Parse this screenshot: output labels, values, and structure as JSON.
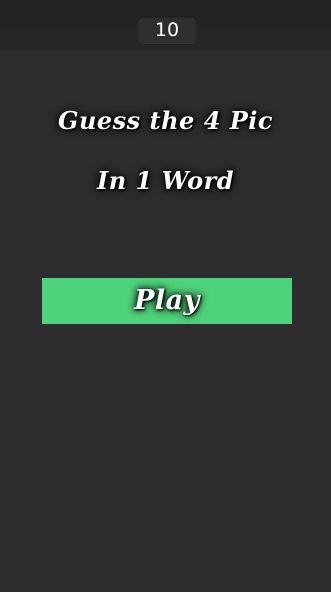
{
  "top_bar": {
    "counter_value": "10"
  },
  "main": {
    "title_line_1": "Guess the 4 Pic",
    "title_line_2": "In 1 Word",
    "play_label": "Play"
  },
  "colors": {
    "background": "#2d2d2f",
    "top_bar": "#232325",
    "play_button": "#4fd37a",
    "text": "#ffffff"
  }
}
